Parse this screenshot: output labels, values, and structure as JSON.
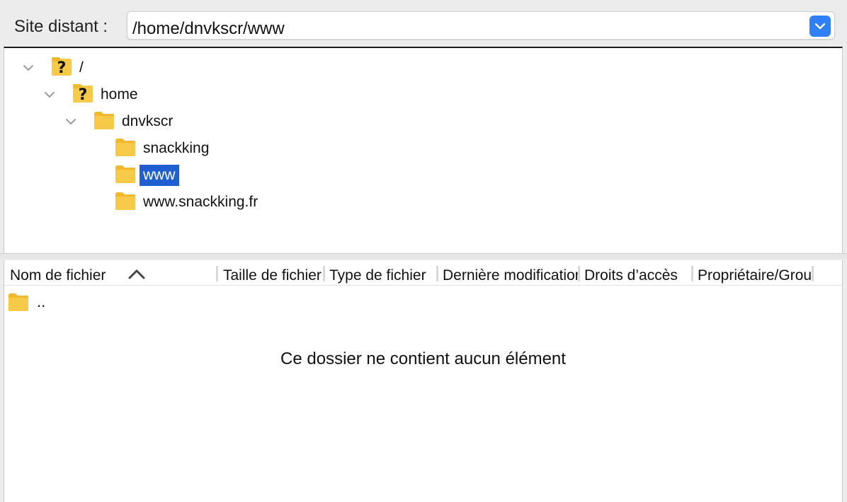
{
  "path_bar": {
    "label": "Site distant :",
    "value": "/home/dnvkscr/www"
  },
  "tree": [
    {
      "label": "/",
      "icon": "unknown-folder-icon",
      "expanded": true
    },
    {
      "label": "home",
      "icon": "unknown-folder-icon",
      "expanded": true
    },
    {
      "label": "dnvkscr",
      "icon": "folder-icon",
      "expanded": true
    },
    {
      "label": "snackking",
      "icon": "folder-icon"
    },
    {
      "label": "www",
      "icon": "folder-icon",
      "selected": true
    },
    {
      "label": "www.snackking.fr",
      "icon": "folder-icon"
    }
  ],
  "columns": [
    "Nom de fichier",
    "Taille de fichier",
    "Type de fichier",
    "Dernière modification",
    "Droits d’accès",
    "Propriétaire/Groupe"
  ],
  "sort": {
    "column": "Nom de fichier",
    "direction": "ascending"
  },
  "files": [
    {
      "name": "..",
      "icon": "folder-icon"
    }
  ],
  "empty_message": "Ce dossier ne contient aucun élément",
  "colors": {
    "accent": "#2f7ff6",
    "selection": "#1f5fd1",
    "folder": "#f7c948"
  }
}
